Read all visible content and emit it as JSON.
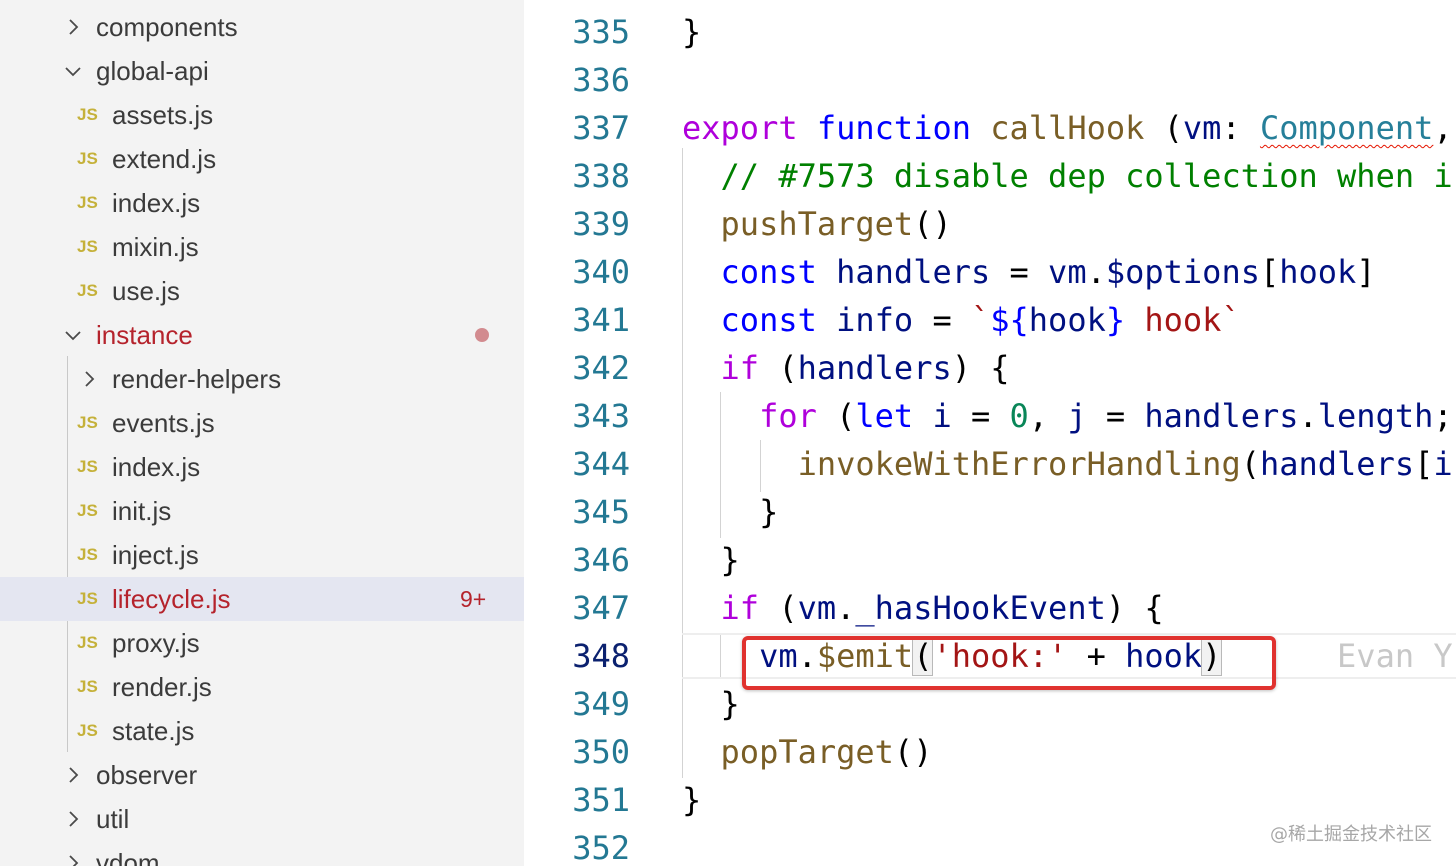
{
  "sidebar": {
    "items": [
      {
        "kind": "folder",
        "expanded": false,
        "label": "components"
      },
      {
        "kind": "folder",
        "expanded": true,
        "label": "global-api"
      },
      {
        "kind": "file",
        "icon": "JS",
        "label": "assets.js"
      },
      {
        "kind": "file",
        "icon": "JS",
        "label": "extend.js"
      },
      {
        "kind": "file",
        "icon": "JS",
        "label": "index.js"
      },
      {
        "kind": "file",
        "icon": "JS",
        "label": "mixin.js"
      },
      {
        "kind": "file",
        "icon": "JS",
        "label": "use.js"
      },
      {
        "kind": "folder",
        "expanded": true,
        "label": "instance",
        "modified": true
      },
      {
        "kind": "folder",
        "expanded": false,
        "label": "render-helpers"
      },
      {
        "kind": "file",
        "icon": "JS",
        "label": "events.js"
      },
      {
        "kind": "file",
        "icon": "JS",
        "label": "index.js"
      },
      {
        "kind": "file",
        "icon": "JS",
        "label": "init.js"
      },
      {
        "kind": "file",
        "icon": "JS",
        "label": "inject.js"
      },
      {
        "kind": "file",
        "icon": "JS",
        "label": "lifecycle.js",
        "selected": true,
        "modified": true,
        "badge": "9+"
      },
      {
        "kind": "file",
        "icon": "JS",
        "label": "proxy.js"
      },
      {
        "kind": "file",
        "icon": "JS",
        "label": "render.js"
      },
      {
        "kind": "file",
        "icon": "JS",
        "label": "state.js"
      },
      {
        "kind": "folder",
        "expanded": false,
        "label": "observer"
      },
      {
        "kind": "folder",
        "expanded": false,
        "label": "util"
      },
      {
        "kind": "folder",
        "expanded": false,
        "label": "vdom"
      }
    ]
  },
  "editor": {
    "current_line": "348",
    "lines": [
      {
        "n": "335",
        "tokens": [
          [
            "p",
            "}"
          ]
        ]
      },
      {
        "n": "336",
        "tokens": []
      },
      {
        "n": "337",
        "tokens": [
          [
            "kw2",
            "export"
          ],
          [
            "p",
            " "
          ],
          [
            "kw",
            "function"
          ],
          [
            "p",
            " "
          ],
          [
            "fn",
            "callHook"
          ],
          [
            "p",
            " ("
          ],
          [
            "var",
            "vm"
          ],
          [
            "p",
            ": "
          ],
          [
            "type",
            "Component"
          ],
          [
            "p",
            ","
          ]
        ]
      },
      {
        "n": "338",
        "tokens": [
          [
            "p",
            "  "
          ],
          [
            "cmt",
            "// #7573 disable dep collection when i"
          ]
        ]
      },
      {
        "n": "339",
        "tokens": [
          [
            "p",
            "  "
          ],
          [
            "fn",
            "pushTarget"
          ],
          [
            "p",
            "()"
          ]
        ]
      },
      {
        "n": "340",
        "tokens": [
          [
            "p",
            "  "
          ],
          [
            "kw",
            "const"
          ],
          [
            "p",
            " "
          ],
          [
            "var",
            "handlers"
          ],
          [
            "p",
            " = "
          ],
          [
            "var",
            "vm"
          ],
          [
            "p",
            "."
          ],
          [
            "var",
            "$options"
          ],
          [
            "p",
            "["
          ],
          [
            "var",
            "hook"
          ],
          [
            "p",
            "]"
          ]
        ]
      },
      {
        "n": "341",
        "tokens": [
          [
            "p",
            "  "
          ],
          [
            "kw",
            "const"
          ],
          [
            "p",
            " "
          ],
          [
            "var",
            "info"
          ],
          [
            "p",
            " = "
          ],
          [
            "str",
            "`"
          ],
          [
            "tpl",
            "${"
          ],
          [
            "var",
            "hook"
          ],
          [
            "tpl",
            "}"
          ],
          [
            "str",
            " hook`"
          ]
        ]
      },
      {
        "n": "342",
        "tokens": [
          [
            "p",
            "  "
          ],
          [
            "kw2",
            "if"
          ],
          [
            "p",
            " ("
          ],
          [
            "var",
            "handlers"
          ],
          [
            "p",
            ") {"
          ]
        ]
      },
      {
        "n": "343",
        "tokens": [
          [
            "p",
            "    "
          ],
          [
            "kw2",
            "for"
          ],
          [
            "p",
            " ("
          ],
          [
            "kw",
            "let"
          ],
          [
            "p",
            " "
          ],
          [
            "var",
            "i"
          ],
          [
            "p",
            " = "
          ],
          [
            "num",
            "0"
          ],
          [
            "p",
            ", "
          ],
          [
            "var",
            "j"
          ],
          [
            "p",
            " = "
          ],
          [
            "var",
            "handlers"
          ],
          [
            "p",
            "."
          ],
          [
            "var",
            "length"
          ],
          [
            "p",
            ";"
          ]
        ]
      },
      {
        "n": "344",
        "tokens": [
          [
            "p",
            "      "
          ],
          [
            "fn",
            "invokeWithErrorHandling"
          ],
          [
            "p",
            "("
          ],
          [
            "var",
            "handlers"
          ],
          [
            "p",
            "["
          ],
          [
            "var",
            "i"
          ]
        ]
      },
      {
        "n": "345",
        "tokens": [
          [
            "p",
            "    }"
          ]
        ]
      },
      {
        "n": "346",
        "tokens": [
          [
            "p",
            "  }"
          ]
        ]
      },
      {
        "n": "347",
        "tokens": [
          [
            "p",
            "  "
          ],
          [
            "kw2",
            "if"
          ],
          [
            "p",
            " ("
          ],
          [
            "var",
            "vm"
          ],
          [
            "p",
            "."
          ],
          [
            "var",
            "_hasHookEvent"
          ],
          [
            "p",
            ") {"
          ]
        ]
      },
      {
        "n": "348",
        "tokens": [
          [
            "p",
            "    "
          ],
          [
            "var",
            "vm"
          ],
          [
            "p",
            "."
          ],
          [
            "fn",
            "$emit"
          ],
          [
            "bh",
            "("
          ],
          [
            "str",
            "'hook:'"
          ],
          [
            "p",
            " + "
          ],
          [
            "var",
            "hook"
          ],
          [
            "bh",
            ")"
          ],
          [
            "p",
            "      "
          ],
          [
            "blame",
            "Evan Y"
          ]
        ]
      },
      {
        "n": "349",
        "tokens": [
          [
            "p",
            "  }"
          ]
        ]
      },
      {
        "n": "350",
        "tokens": [
          [
            "p",
            "  "
          ],
          [
            "fn",
            "popTarget"
          ],
          [
            "p",
            "()"
          ]
        ]
      },
      {
        "n": "351",
        "tokens": [
          [
            "p",
            "}"
          ]
        ]
      },
      {
        "n": "352",
        "tokens": []
      }
    ]
  },
  "watermark": "@稀土掘金技术社区",
  "colors": {
    "sidebar_bg": "#f3f3f3",
    "selected_bg": "#e4e6f1",
    "modified_text": "#b5232c",
    "js_icon": "#c5b13a",
    "line_number": "#237893",
    "highlight_box": "#e0322f"
  },
  "icons": {
    "folder_collapsed": "chevron-right-icon",
    "folder_expanded": "chevron-down-icon",
    "file": "js-file-icon"
  }
}
